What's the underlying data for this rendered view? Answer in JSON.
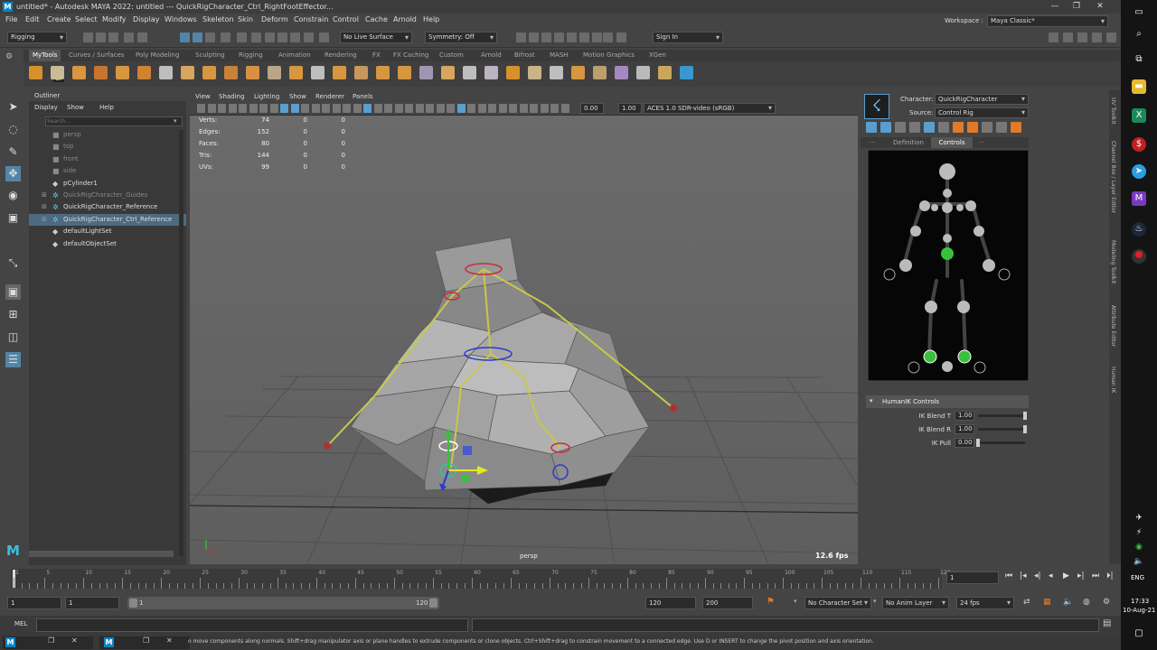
{
  "window": {
    "title": "untitled* - Autodesk MAYA 2022: untitled   ---   QuickRigCharacter_Ctrl_RightFootEffector...",
    "app_icon": "M"
  },
  "menus": [
    "File",
    "Edit",
    "Create",
    "Select",
    "Modify",
    "Display",
    "Windows",
    "Skeleton",
    "Skin",
    "Deform",
    "Constrain",
    "Control",
    "Cache",
    "Arnold",
    "Help"
  ],
  "workspace": {
    "label": "Workspace :",
    "value": "Maya Classic*"
  },
  "status_line": {
    "menu_set": "Rigging",
    "live_surface": "No Live Surface",
    "symmetry": "Symmetry: Off",
    "sign_in": "Sign In"
  },
  "shelf_tabs": [
    "MyTools",
    "Curves / Surfaces",
    "Poly Modeling",
    "Sculpting",
    "Rigging",
    "Animation",
    "Rendering",
    "FX",
    "FX Caching",
    "Custom",
    "Arnold",
    "Bifrost",
    "MASH",
    "Motion Graphics",
    "XGen"
  ],
  "shelf_badge": "CP",
  "outliner": {
    "title": "Outliner",
    "menu": [
      "Display",
      "Show",
      "Help"
    ],
    "search_placeholder": "Search...",
    "items": [
      {
        "label": "persp",
        "dim": true
      },
      {
        "label": "top",
        "dim": true
      },
      {
        "label": "front",
        "dim": true
      },
      {
        "label": "side",
        "dim": true
      },
      {
        "label": "pCylinder1",
        "dim": false
      },
      {
        "label": "QuickRigCharacter_Guides",
        "dim": true
      },
      {
        "label": "QuickRigCharacter_Reference",
        "dim": false
      },
      {
        "label": "QuickRigCharacter_Ctrl_Reference",
        "dim": false
      },
      {
        "label": "defaultLightSet",
        "dim": false
      },
      {
        "label": "defaultObjectSet",
        "dim": false
      }
    ]
  },
  "viewport": {
    "menu": [
      "View",
      "Shading",
      "Lighting",
      "Show",
      "Renderer",
      "Panels"
    ],
    "exposure": "0.00",
    "gamma": "1.00",
    "color_space": "ACES 1.0 SDR-video (sRGB)",
    "camera": "persp",
    "fps": "12.6 fps",
    "hud": [
      {
        "label": "Verts:",
        "v1": "74",
        "v2": "0",
        "v3": "0"
      },
      {
        "label": "Edges:",
        "v1": "152",
        "v2": "0",
        "v3": "0"
      },
      {
        "label": "Faces:",
        "v1": "80",
        "v2": "0",
        "v3": "0"
      },
      {
        "label": "Tris:",
        "v1": "144",
        "v2": "0",
        "v3": "0"
      },
      {
        "label": "UVs:",
        "v1": "99",
        "v2": "0",
        "v3": "0"
      }
    ]
  },
  "humanik": {
    "character_label": "Character:",
    "character": "QuickRigCharacter",
    "source_label": "Source:",
    "source": "Control Rig",
    "tabs": [
      "Definition",
      "Controls"
    ],
    "section": "HumanIK Controls",
    "sliders": [
      {
        "label": "IK Blend T",
        "value": "1.00",
        "fraction": 1.0
      },
      {
        "label": "IK Blend R",
        "value": "1.00",
        "fraction": 1.0
      },
      {
        "label": "IK Pull",
        "value": "0.00",
        "fraction": 0.0
      }
    ]
  },
  "dock_tabs": [
    "UV Toolkit",
    "Channel Box / Layer Editor",
    "Modeling Toolkit",
    "Attribute Editor",
    "Human IK"
  ],
  "timeline": {
    "ticks": [
      "1",
      "5",
      "10",
      "15",
      "20",
      "25",
      "30",
      "35",
      "40",
      "45",
      "50",
      "55",
      "60",
      "65",
      "70",
      "75",
      "80",
      "85",
      "90",
      "95",
      "100",
      "105",
      "110",
      "115",
      "120"
    ],
    "current_frame": "1"
  },
  "range": {
    "start": "1",
    "inner_start": "1",
    "slider_start": "1",
    "slider_end": "120",
    "end": "120",
    "outer_end": "200",
    "character_set": "No Character Set",
    "anim_layer": "No Anim Layer",
    "fps": "24 fps"
  },
  "command": {
    "label": "MEL"
  },
  "help_text": "o move components along normals. Shift+drag manipulator axis or plane handles to extrude components or clone objects. Ctrl+Shift+drag to constrain movement to a connected edge. Use D or INSERT to change the pivot position and axis orientation.",
  "taskbar": {
    "language": "ENG",
    "time": "17:33",
    "date": "10-Aug-21"
  }
}
